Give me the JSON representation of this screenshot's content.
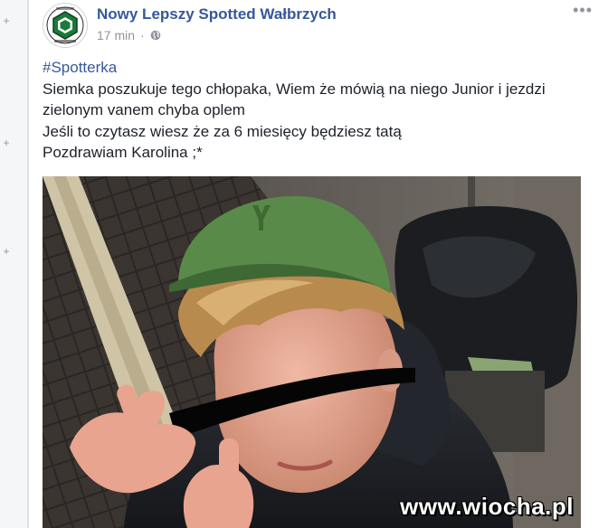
{
  "post": {
    "page_name": "Nowy Lepszy Spotted Wałbrzych",
    "time": "17 min",
    "separator": "·",
    "more_label": "•••",
    "hashtag": "#Spotterka",
    "lines": [
      "Siemka poszukuje tego chłopaka, Wiem że mówią na niego Junior i jezdzi",
      "zielonym vanem chyba oplem",
      "Jeśli to czytasz wiesz że za 6 miesięcy będziesz tatą",
      "Pozdrawiam Karolina ;*"
    ]
  },
  "gutter": {
    "plus": "+"
  },
  "photo": {
    "watermark": "www.wiocha.pl",
    "description_icons": [
      "profile-logo-icon",
      "globe-icon"
    ]
  },
  "colors": {
    "link": "#365899",
    "text": "#1d2129",
    "meta": "#90949c",
    "logo_green": "#1a7a3a",
    "cap_green": "#5a8a4a"
  }
}
